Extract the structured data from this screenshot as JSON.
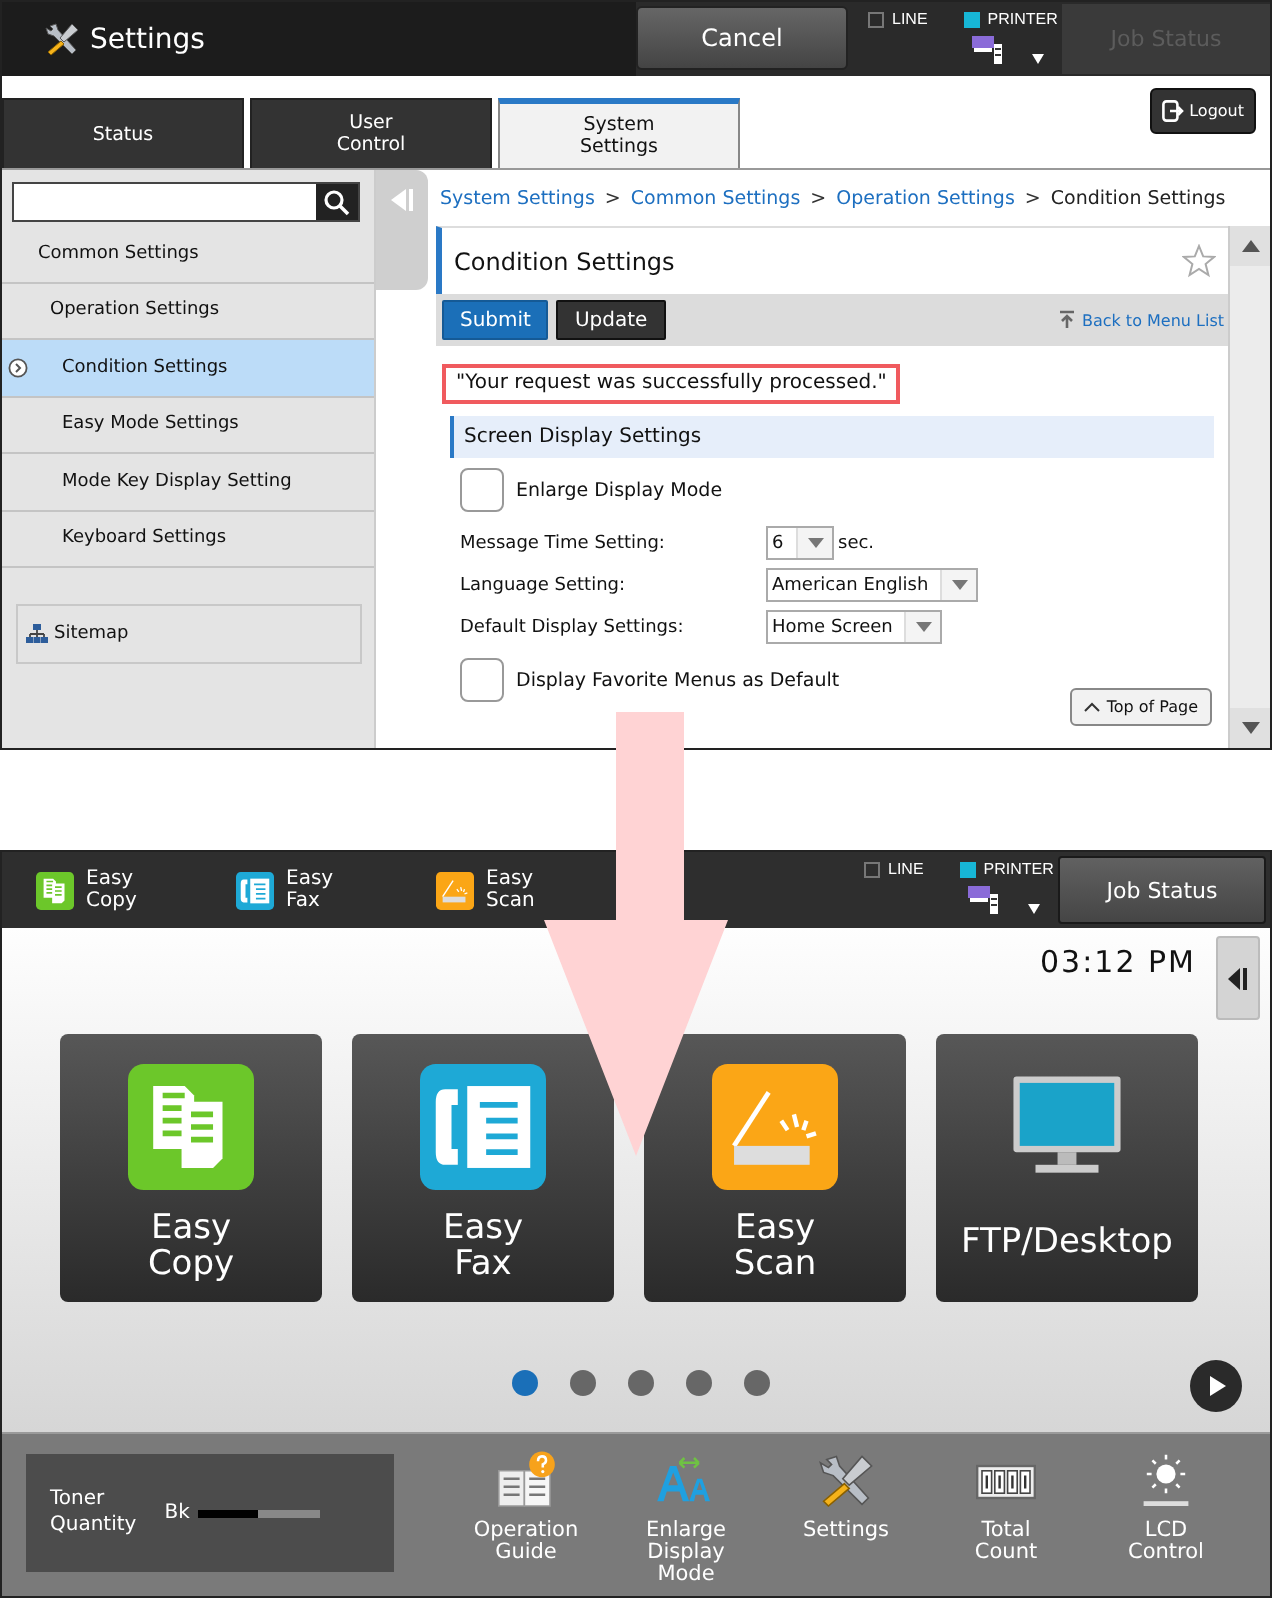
{
  "settings_screen": {
    "header": {
      "title": "Settings",
      "cancel": "Cancel",
      "indicators": [
        {
          "label": "LINE",
          "on": false
        },
        {
          "label": "PRINTER",
          "on": true
        }
      ],
      "job_status": {
        "label": "Job Status",
        "disabled": true
      }
    },
    "tabs": [
      {
        "label": "Status",
        "selected": false
      },
      {
        "label": "User Control",
        "selected": false
      },
      {
        "label": "System Settings",
        "selected": true
      }
    ],
    "logout": "Logout",
    "sidebar": {
      "items": [
        {
          "label": "Common Settings",
          "selected": false,
          "children": [
            {
              "label": "Operation Settings",
              "selected": false,
              "children": [
                {
                  "label": "Condition Settings",
                  "selected": true
                },
                {
                  "label": "Easy Mode Settings",
                  "selected": false
                },
                {
                  "label": "Mode Key Display Setting",
                  "selected": false
                },
                {
                  "label": "Keyboard Settings",
                  "selected": false
                }
              ]
            }
          ]
        }
      ],
      "sitemap": "Sitemap"
    },
    "breadcrumb": [
      {
        "label": "System Settings",
        "kind": "link",
        "separator": ">"
      },
      {
        "label": "Common Settings",
        "kind": "link",
        "separator": ">"
      },
      {
        "label": "Operation Settings",
        "kind": "link",
        "separator": ">"
      },
      {
        "label": "Condition Settings",
        "kind": "current"
      }
    ],
    "page_title": "Condition Settings",
    "buttons": [
      {
        "label": "Submit",
        "kind": "primary"
      },
      {
        "label": "Update",
        "kind": "secondary"
      }
    ],
    "back_link": "Back to Menu List",
    "message": "\"Your request was successfully processed.\"",
    "section": "Screen Display Settings",
    "fields": [
      {
        "kind": "checkbox",
        "label": "Enlarge Display Mode",
        "checked": false
      },
      {
        "kind": "select",
        "label": "Message Time Setting:",
        "value": "6",
        "unit": "sec."
      },
      {
        "kind": "select",
        "label": "Language Setting:",
        "value": "American English"
      },
      {
        "kind": "select",
        "label": "Default Display Settings:",
        "value": "Home Screen"
      },
      {
        "kind": "checkbox",
        "label": "Display Favorite Menus as Default",
        "checked": false
      }
    ],
    "top_of_page": "Top of Page"
  },
  "home_screen": {
    "header": {
      "shortcuts": [
        {
          "label": "Easy Copy",
          "kind": "copy"
        },
        {
          "label": "Easy Fax",
          "kind": "fax"
        },
        {
          "label": "Easy Scan",
          "kind": "scan"
        }
      ],
      "indicators": [
        {
          "label": "LINE",
          "on": false
        },
        {
          "label": "PRINTER",
          "on": true
        }
      ],
      "job_status": {
        "label": "Job Status",
        "disabled": false
      }
    },
    "time": "03:12 PM",
    "tiles": [
      {
        "label": "Easy Copy",
        "kind": "copy"
      },
      {
        "label": "Easy Fax",
        "kind": "fax"
      },
      {
        "label": "Easy Scan",
        "kind": "scan"
      },
      {
        "label": "FTP/Desktop",
        "kind": "desktop"
      }
    ],
    "pages": [
      {
        "selected": true
      },
      {
        "selected": false
      },
      {
        "selected": false
      },
      {
        "selected": false
      },
      {
        "selected": false
      }
    ],
    "toner": {
      "label": "Toner Quantity",
      "color_label": "Bk",
      "level": 0.5
    },
    "tools": [
      {
        "label": "Operation Guide",
        "kind": "guide"
      },
      {
        "label": "Enlarge Display Mode",
        "kind": "enlarge"
      },
      {
        "label": "Settings",
        "kind": "settings"
      },
      {
        "label": "Total Count",
        "kind": "count"
      },
      {
        "label": "LCD Control",
        "kind": "lcd"
      }
    ]
  }
}
